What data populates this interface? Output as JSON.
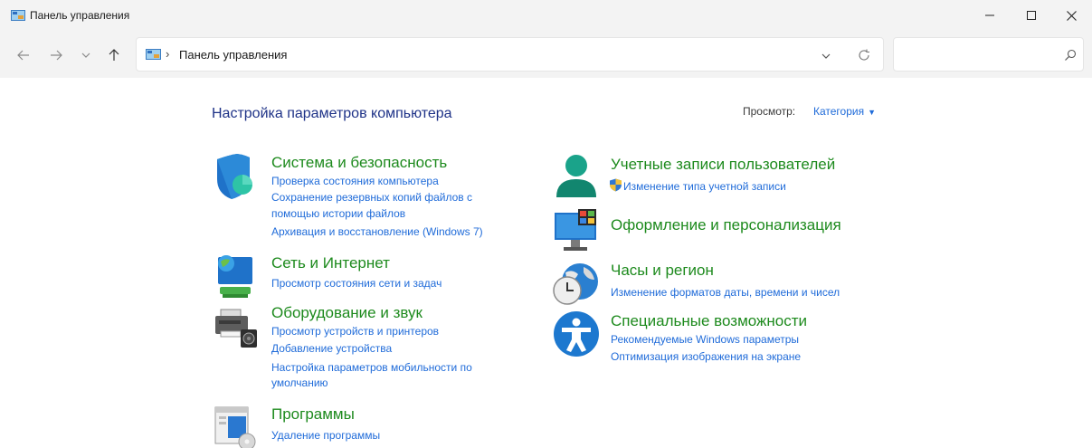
{
  "window": {
    "title": "Панель управления"
  },
  "address": {
    "separator": "›",
    "crumb": "Панель управления"
  },
  "search": {
    "placeholder": ""
  },
  "header": {
    "title": "Настройка параметров компьютера",
    "view_label": "Просмотр:",
    "view_value": "Категория"
  },
  "categories_left": [
    {
      "title": "Система и безопасность",
      "icon": "shield-icon",
      "links": [
        "Проверка состояния компьютера",
        "Сохранение резервных копий файлов с",
        "помощью истории файлов",
        "Архивация и восстановление (Windows 7)"
      ]
    },
    {
      "title": "Сеть и Интернет",
      "icon": "network-icon",
      "links": [
        "Просмотр состояния сети и задач"
      ]
    },
    {
      "title": "Оборудование и звук",
      "icon": "printer-icon",
      "links": [
        "Просмотр устройств и принтеров",
        "Добавление устройства",
        "Настройка параметров мобильности по",
        "умолчанию"
      ]
    },
    {
      "title": "Программы",
      "icon": "programs-icon",
      "links": [
        "Удаление программы"
      ]
    }
  ],
  "categories_right": [
    {
      "title": "Учетные записи пользователей",
      "icon": "user-icon",
      "links": [
        "Изменение типа учетной записи"
      ]
    },
    {
      "title": "Оформление и персонализация",
      "icon": "monitor-icon",
      "links": []
    },
    {
      "title": "Часы и регион",
      "icon": "clock-globe-icon",
      "links": [
        "Изменение форматов даты, времени и чисел"
      ]
    },
    {
      "title": "Специальные возможности",
      "icon": "accessibility-icon",
      "links": [
        "Рекомендуемые Windows параметры",
        "Оптимизация изображения на экране"
      ]
    }
  ],
  "colors": {
    "category_title": "#1d8a1d",
    "link": "#1f6bd9",
    "page_title": "#1e3287",
    "chrome_bg": "#f3f3f3"
  }
}
